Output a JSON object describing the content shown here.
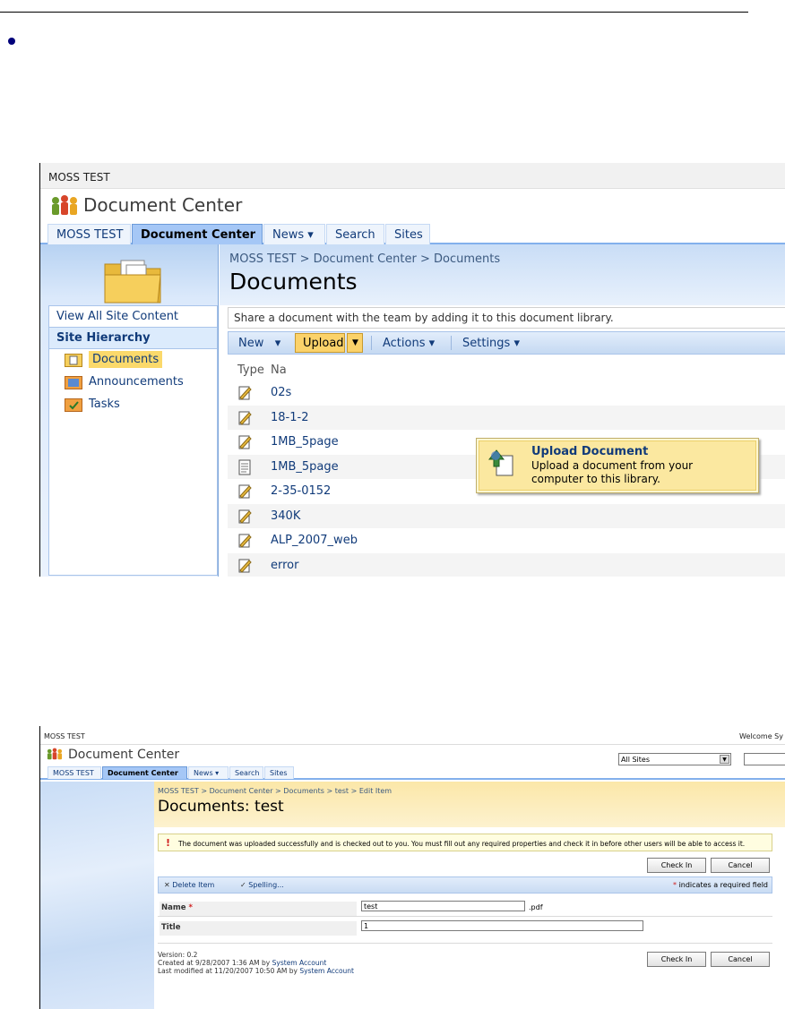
{
  "screen1": {
    "site_bar": "MOSS TEST",
    "site_title": "Document Center",
    "tabs": [
      "MOSS TEST",
      "Document Center",
      "News",
      "Search",
      "Sites"
    ],
    "breadcrumb": "MOSS TEST > Document Center > Documents",
    "page_title": "Documents",
    "quick_launch": {
      "view_all": "View All Site Content",
      "heading": "Site Hierarchy",
      "items": [
        "Documents",
        "Announcements",
        "Tasks"
      ]
    },
    "description": "Share a document with the team by adding it to this document library.",
    "toolbar": {
      "new": "New",
      "upload": "Upload",
      "actions": "Actions",
      "settings": "Settings"
    },
    "columns": {
      "type": "Type",
      "name": "Na"
    },
    "upload_menu": {
      "title": "Upload Document",
      "description": "Upload a document from your computer to this library."
    },
    "documents": [
      {
        "name": "02s",
        "icon": "pdf-file-icon"
      },
      {
        "name": "18-1-2",
        "icon": "pdf-file-icon"
      },
      {
        "name": "1MB_5page",
        "icon": "pdf-file-icon"
      },
      {
        "name": "1MB_5page",
        "icon": "generic-file-icon"
      },
      {
        "name": "2-35-0152",
        "icon": "pdf-file-icon"
      },
      {
        "name": "340K",
        "icon": "pdf-file-icon"
      },
      {
        "name": "ALP_2007_web",
        "icon": "pdf-file-icon"
      },
      {
        "name": "error",
        "icon": "pdf-file-icon"
      }
    ]
  },
  "screen2": {
    "site_bar": "MOSS TEST",
    "welcome": "Welcome Sy",
    "site_title": "Document Center",
    "search_scope": "All Sites",
    "tabs": [
      "MOSS TEST",
      "Document Center",
      "News",
      "Search",
      "Sites"
    ],
    "breadcrumb": "MOSS TEST > Document Center > Documents > test > Edit Item",
    "page_title": "Documents: test",
    "message": "The document was uploaded successfully and is checked out to you. You must fill out any required properties and check it in before other users will be able to access it.",
    "check_in": "Check In",
    "cancel": "Cancel",
    "delete_item": "Delete Item",
    "spelling": "Spelling...",
    "required_note": "indicates a required field",
    "fields": {
      "name_label": "Name",
      "name_value": "test",
      "name_ext": ".pdf",
      "title_label": "Title",
      "title_value": "1"
    },
    "meta": {
      "version": "Version: 0.2",
      "created": "Created at 9/28/2007 1:36 AM  by",
      "modified": "Last modified at 11/20/2007 10:50 AM  by",
      "user": "System Account"
    }
  }
}
